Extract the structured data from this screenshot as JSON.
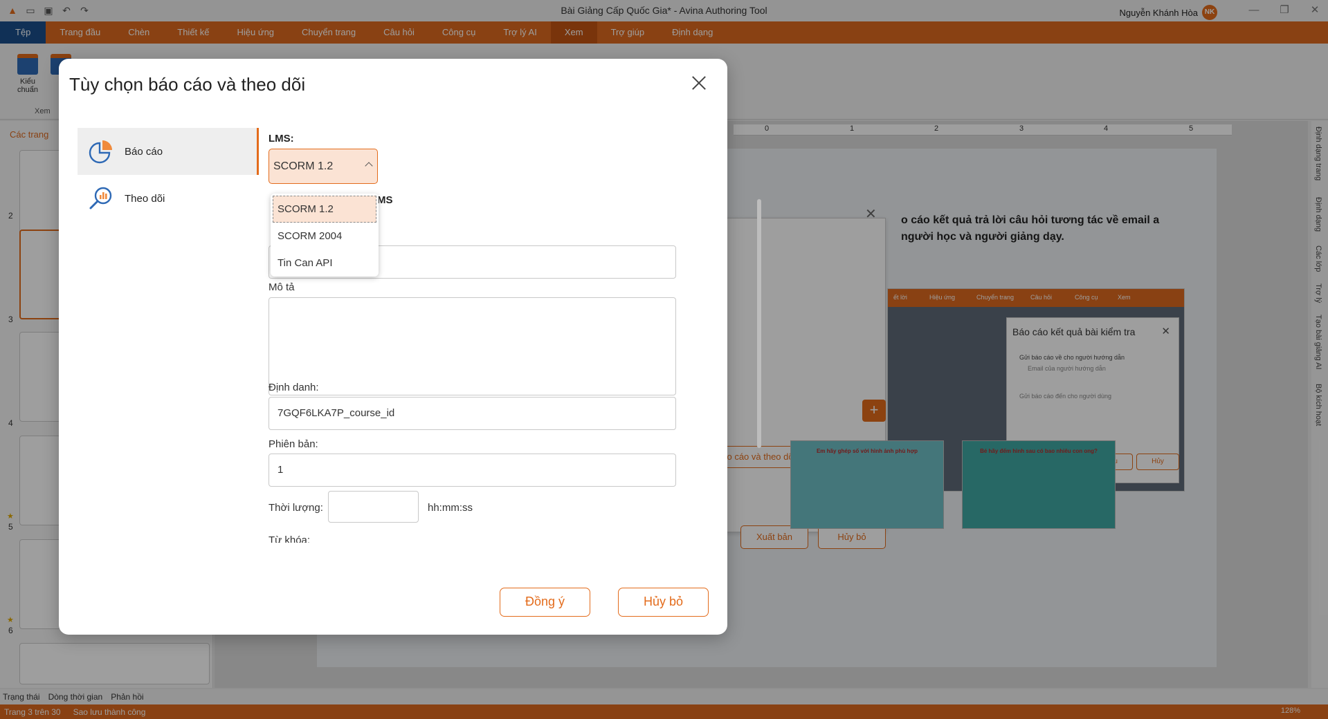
{
  "window": {
    "title": "Bài Giảng Cấp Quốc Gia* - Avina Authoring Tool",
    "user_name": "Nguyễn Khánh Hòa",
    "user_initials": "NK"
  },
  "ribbon": {
    "tabs": [
      "Tệp",
      "Trang đầu",
      "Chèn",
      "Thiết kế",
      "Hiệu ứng",
      "Chuyển trang",
      "Câu hỏi",
      "Công cụ",
      "Trợ lý AI",
      "Xem",
      "Trợ giúp",
      "Định dạng"
    ],
    "active_tab": "Xem",
    "item_label": "Kiểu chuẩn",
    "group_label": "Xem"
  },
  "left_pane": {
    "title": "Các trang",
    "slide_numbers": [
      "2",
      "3",
      "4",
      "5",
      "6"
    ]
  },
  "canvas": {
    "ruler_marks": [
      "0",
      "1",
      "2",
      "3",
      "4",
      "5"
    ],
    "slide_text": "o cáo kết quả trả lời câu hỏi tương tác về email a người học và người giảng dạy.",
    "bg_button_partial": "o cáo và theo dõi",
    "bg_publish": "Xuất bản",
    "bg_cancel": "Hủy bỏ",
    "inner_tabs": [
      "ết lời",
      "Hiệu ứng",
      "Chuyển trang",
      "Câu hỏi",
      "Công cụ",
      "Xem"
    ],
    "inner_dialog_title": "Báo cáo kết quả bài kiểm tra",
    "inner_opt1": "Gửi báo cáo về cho người hướng dẫn",
    "inner_opt1_sub": "Email của người hướng dẫn",
    "inner_opt2": "Gửi báo cáo đến cho người dùng",
    "inner_save": "Lưu",
    "inner_cancel": "Hủy",
    "mini_slide_1_title": "Em hãy ghép số với hình ảnh phù hợp",
    "mini_slide_2_title": "Bé hãy đếm hình sau có bao nhiêu con ong?"
  },
  "right_tabs": [
    "Định dạng trang",
    "Định dạng",
    "Các lớp",
    "Trợ lý",
    "Tạo bài giảng AI",
    "Bộ kích hoạt"
  ],
  "bottom_tabs": [
    "Trạng thái",
    "Dòng thời gian",
    "Phản hồi"
  ],
  "status": {
    "page": "Trang 3 trên 30",
    "saved": "Sao lưu thành công",
    "zoom": "128%"
  },
  "modal": {
    "title": "Tùy chọn báo cáo và theo dõi",
    "nav": [
      {
        "label": "Báo cáo",
        "icon": "pie-chart-icon",
        "active": true
      },
      {
        "label": "Theo dõi",
        "icon": "analytics-search-icon",
        "active": false
      }
    ],
    "lms_label": "LMS:",
    "lms_value": "SCORM 1.2",
    "lms_options": [
      "SCORM 1.2",
      "SCORM 2004",
      "Tin Can API"
    ],
    "section_partial": "MS",
    "desc_label": "Mô tả",
    "identifier_label": "Định danh:",
    "identifier_value": "7GQF6LKA7P_course_id",
    "version_label": "Phiên bản:",
    "version_value": "1",
    "duration_label": "Thời lượng:",
    "duration_unit": "hh:mm:ss",
    "keywords_label": "Từ khóa:",
    "ok_button": "Đồng ý",
    "cancel_button": "Hủy bỏ"
  },
  "colors": {
    "accent": "#e36b1b",
    "ribbon": "#dd6a1f",
    "file_tab": "#1a4e8c",
    "selected_fill": "#fbe3d4"
  }
}
